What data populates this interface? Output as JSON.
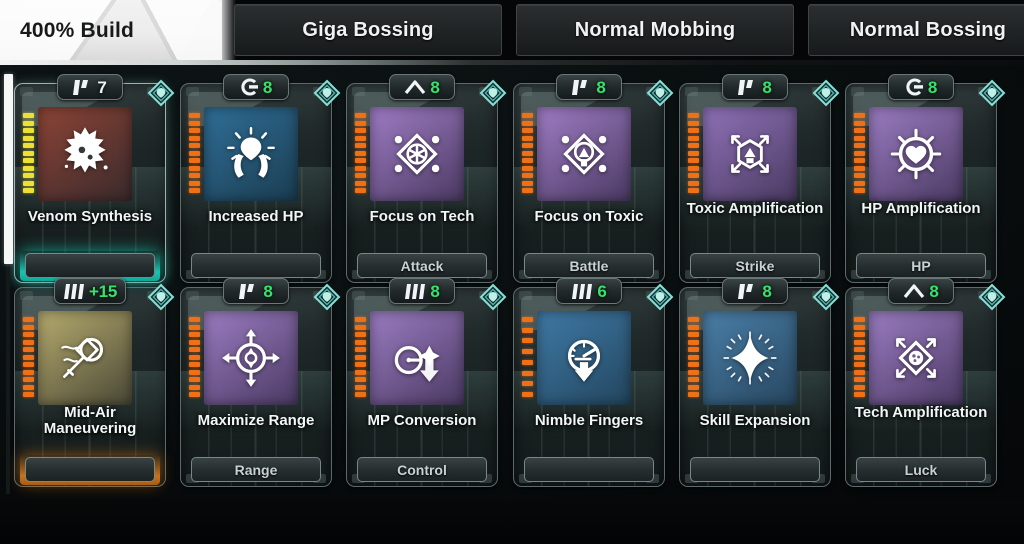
{
  "tabs": [
    {
      "id": "build",
      "label": "400% Build",
      "active": true
    },
    {
      "id": "giga",
      "label": "Giga Bossing",
      "active": false
    },
    {
      "id": "mobbing",
      "label": "Normal Mobbing",
      "active": false
    },
    {
      "id": "bossing",
      "label": "Normal Bossing",
      "active": false
    }
  ],
  "colors": {
    "badge_green": "#35e36a",
    "badge_white": "#eef2f2",
    "meter_orange": "#ef7016",
    "meter_yellow": "#ece036",
    "glow_teal": "#18c2ad",
    "glow_orange": "#c8721b",
    "gem_teal": "#7fd6cc",
    "active_tab_bg": "#ececec",
    "inactive_tab_bg": "#202425"
  },
  "cards": [
    {
      "title": "Venom Synthesis",
      "category": "",
      "badge_glyph": "bar-flag-glyph",
      "badge_value": "7",
      "badge_value_color": "white",
      "meter": "yellow",
      "meter_segments": 11,
      "art_icon": "venom-splatter-icon",
      "art_bg": [
        "#8c4436",
        "#3a2a2c"
      ],
      "glow": "teal",
      "selected": true
    },
    {
      "title": "Increased HP",
      "category": "",
      "badge_glyph": "c-rank-glyph",
      "badge_value": "8",
      "badge_value_color": "green",
      "meter": "orange",
      "meter_segments": 11,
      "art_icon": "healing-hands-heart-icon",
      "art_bg": [
        "#2f6e96",
        "#1b3d52"
      ],
      "glow": "",
      "selected": false
    },
    {
      "title": "Focus on Tech",
      "category": "Attack",
      "badge_glyph": "chevron-up-glyph",
      "badge_value": "8",
      "badge_value_color": "green",
      "meter": "orange",
      "meter_segments": 11,
      "art_icon": "tech-gear-diamond-icon",
      "art_bg": [
        "#9f7cc4",
        "#4b3a63"
      ],
      "glow": "",
      "selected": false
    },
    {
      "title": "Focus on Toxic",
      "category": "Battle",
      "badge_glyph": "bar-flag-glyph",
      "badge_value": "8",
      "badge_value_color": "green",
      "meter": "orange",
      "meter_segments": 11,
      "art_icon": "toxic-drop-diamond-icon",
      "art_bg": [
        "#9f7cc4",
        "#4b3a63"
      ],
      "glow": "",
      "selected": false
    },
    {
      "title": "Toxic Amplification",
      "category": "Strike",
      "badge_glyph": "bar-flag-glyph",
      "badge_value": "8",
      "badge_value_color": "green",
      "meter": "orange",
      "meter_segments": 11,
      "art_icon": "toxic-cube-expand-icon",
      "art_bg": [
        "#8f72b8",
        "#4a3a61"
      ],
      "glow": "",
      "selected": false
    },
    {
      "title": "HP Amplification",
      "category": "HP",
      "badge_glyph": "c-rank-glyph",
      "badge_value": "8",
      "badge_value_color": "green",
      "meter": "orange",
      "meter_segments": 11,
      "art_icon": "heart-burst-icon",
      "art_bg": [
        "#9b7cc2",
        "#4b3a63"
      ],
      "glow": "",
      "selected": false
    },
    {
      "title": "Mid-Air Maneuvering",
      "category": "",
      "badge_glyph": "triple-bars-glyph",
      "badge_value": "+15",
      "badge_value_color": "green",
      "meter": "orange",
      "meter_segments": 11,
      "art_icon": "airborne-blade-icon",
      "art_bg": [
        "#b6ab6e",
        "#4a4836"
      ],
      "glow": "orange",
      "selected": false
    },
    {
      "title": "Maximize Range",
      "category": "Range",
      "badge_glyph": "bar-flag-glyph",
      "badge_value": "8",
      "badge_value_color": "green",
      "meter": "orange",
      "meter_segments": 11,
      "art_icon": "crosshair-expand-icon",
      "art_bg": [
        "#9b7cc2",
        "#4b3a63"
      ],
      "glow": "",
      "selected": false
    },
    {
      "title": "MP Conversion",
      "category": "Control",
      "badge_glyph": "triple-bars-glyph",
      "badge_value": "8",
      "badge_value_color": "green",
      "meter": "orange",
      "meter_segments": 11,
      "art_icon": "gauge-down-arrow-icon",
      "art_bg": [
        "#9b7cc2",
        "#4b3a63"
      ],
      "glow": "",
      "selected": false
    },
    {
      "title": "Nimble Fingers",
      "category": "",
      "badge_glyph": "triple-bars-glyph",
      "badge_value": "6",
      "badge_value_color": "green",
      "meter": "orange",
      "meter_segments": 8,
      "art_icon": "speed-gauge-down-icon",
      "art_bg": [
        "#3f7aa6",
        "#23455e"
      ],
      "glow": "",
      "selected": false
    },
    {
      "title": "Skill Expansion",
      "category": "",
      "badge_glyph": "bar-flag-glyph",
      "badge_value": "8",
      "badge_value_color": "green",
      "meter": "orange",
      "meter_segments": 11,
      "art_icon": "sparkle-star-dial-icon",
      "art_bg": [
        "#4a7fa8",
        "#27465f"
      ],
      "glow": "",
      "selected": false
    },
    {
      "title": "Tech Amplification",
      "category": "Luck",
      "badge_glyph": "chevron-up-glyph",
      "badge_value": "8",
      "badge_value_color": "green",
      "meter": "orange",
      "meter_segments": 11,
      "art_icon": "tech-diamond-expand-icon",
      "art_bg": [
        "#9b7cc2",
        "#4b3a63"
      ],
      "glow": "",
      "selected": false
    }
  ]
}
